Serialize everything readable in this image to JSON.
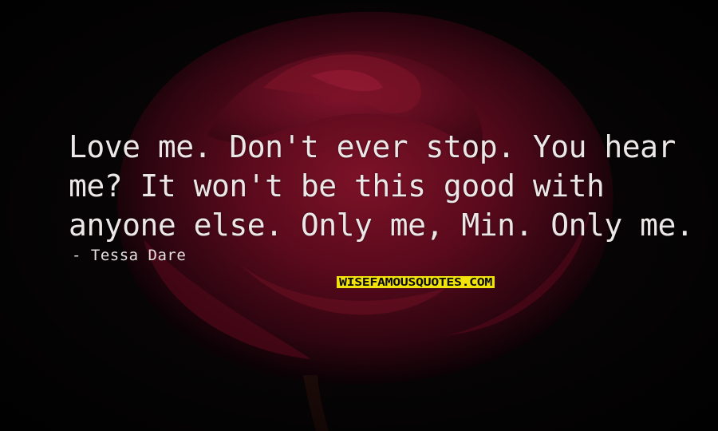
{
  "quote": {
    "lines": [
      "Love me. Don't ever stop. You hear",
      "me? It won't be this good with",
      "anyone else. Only me, Min. Only me."
    ]
  },
  "author": "- Tessa Dare",
  "watermark": {
    "text": "WISEFAMOUSQUOTES.COM",
    "color_bg": "#f2e20b",
    "color_text": "#0a0a0a"
  },
  "colors": {
    "background": "#060405",
    "rose": "#5c0a1c",
    "text": "#ece7e7"
  }
}
